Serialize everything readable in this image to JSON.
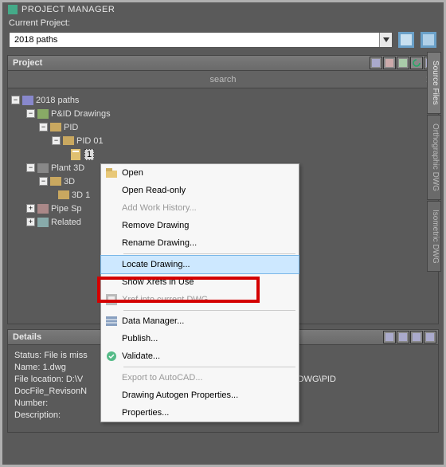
{
  "window": {
    "title": "PROJECT MANAGER"
  },
  "current_project": {
    "label": "Current Project:",
    "value": "2018 paths"
  },
  "project_panel": {
    "title": "Project",
    "search_placeholder": "search"
  },
  "tree": {
    "root": "2018 paths",
    "pid_drawings": "P&ID Drawings",
    "pid": "PID",
    "pid01": "PID 01",
    "item1": "1",
    "plant3d": "Plant 3D",
    "n3d": "3D",
    "n3d1": "3D 1",
    "pipespecs": "Pipe Sp",
    "related": "Related"
  },
  "context_menu": {
    "items": [
      {
        "label": "Open",
        "icon": "folder-open-icon",
        "disabled": false
      },
      {
        "label": "Open Read-only",
        "disabled": false
      },
      {
        "label": "Add Work History...",
        "disabled": true
      },
      {
        "label": "Remove Drawing",
        "disabled": false
      },
      {
        "label": "Rename Drawing...",
        "disabled": false
      },
      {
        "sep": true
      },
      {
        "label": "Locate Drawing...",
        "disabled": false,
        "highlighted": true
      },
      {
        "label": "Show Xrefs in Use",
        "disabled": false
      },
      {
        "label": "Xref into current DWG",
        "icon": "xref-icon",
        "disabled": true
      },
      {
        "sep": true
      },
      {
        "label": "Data Manager...",
        "icon": "data-manager-icon",
        "disabled": false
      },
      {
        "label": "Publish...",
        "disabled": false
      },
      {
        "label": "Validate...",
        "icon": "validate-icon",
        "disabled": false
      },
      {
        "sep": true
      },
      {
        "label": "Export to AutoCAD...",
        "disabled": true
      },
      {
        "label": "Drawing Autogen Properties...",
        "disabled": false
      },
      {
        "label": "Properties...",
        "disabled": false
      }
    ]
  },
  "details_panel": {
    "title": "Details",
    "status_label": "Status:",
    "status_value": "File is miss",
    "name_label": "Name:",
    "name_value": "1.dwg",
    "location_label": "File location:",
    "location_value_left": "D:\\V",
    "location_value_right": "PID DWG\\PID",
    "docfile_label": "DocFile_RevisonN",
    "number_label": "Number:",
    "description_label": "Description:"
  },
  "side_tabs": {
    "tab1": "Source Files",
    "tab2": "Orthographic DWG",
    "tab3": "Isometric DWG"
  }
}
